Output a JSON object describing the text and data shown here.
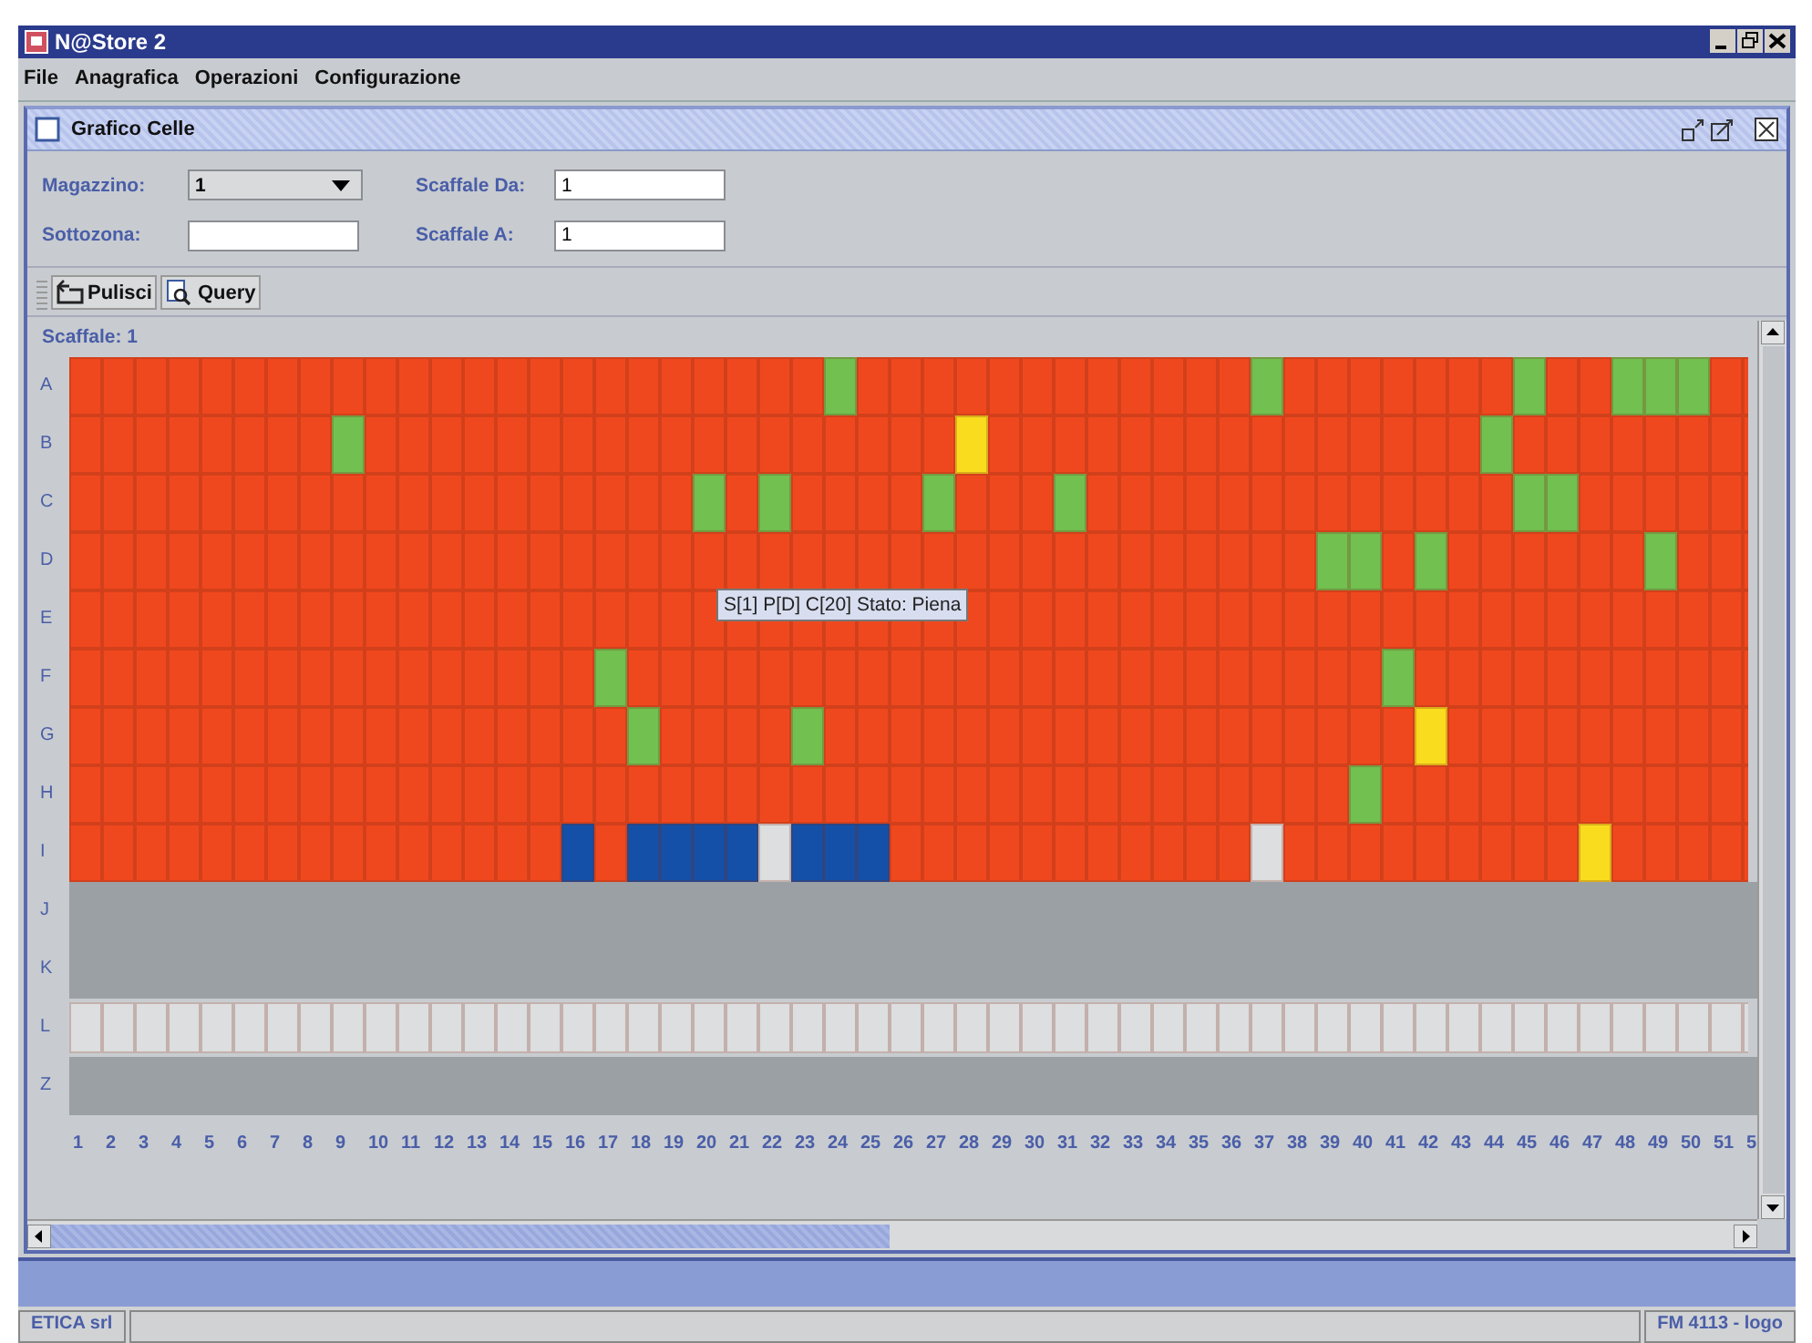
{
  "window": {
    "title": "N@Store 2"
  },
  "menu": [
    "File",
    "Anagrafica",
    "Operazioni",
    "Configurazione"
  ],
  "frame": {
    "title": "Grafico Celle"
  },
  "form": {
    "magazzino_label": "Magazzino:",
    "magazzino_value": "1",
    "sottozona_label": "Sottozona:",
    "scaffale_da_label": "Scaffale Da:",
    "scaffale_da_value": "1",
    "scaffale_a_label": "Scaffale A:",
    "scaffale_a_value": "1"
  },
  "toolbar": [
    "Pulisci",
    "Query"
  ],
  "shelf_label": "Scaffale: 1",
  "rows": [
    {
      "label": "A",
      "kind": "cells",
      "cells": [
        {
          "color": "#f0481e"
        },
        {
          "color": "#f0481e"
        },
        {
          "color": "#f0481e"
        },
        {
          "color": "#f0481e"
        },
        {
          "color": "#f0481e"
        },
        {
          "color": "#f0481e"
        },
        {
          "color": "#f0481e"
        },
        {
          "color": "#f0481e"
        },
        {
          "color": "#f0481e"
        },
        {
          "color": "#f0481e"
        },
        {
          "color": "#f0481e"
        },
        {
          "color": "#f0481e"
        },
        {
          "color": "#f0481e"
        },
        {
          "color": "#f0481e"
        },
        {
          "color": "#f0481e"
        },
        {
          "color": "#f0481e"
        },
        {
          "color": "#f0481e"
        },
        {
          "color": "#f0481e"
        },
        {
          "color": "#f0481e"
        },
        {
          "color": "#f0481e"
        },
        {
          "color": "#f0481e"
        },
        {
          "color": "#f0481e"
        },
        {
          "color": "#f0481e"
        },
        {
          "color": "#72c050"
        },
        {
          "color": "#f0481e"
        },
        {
          "color": "#f0481e"
        },
        {
          "color": "#f0481e"
        },
        {
          "color": "#f0481e"
        },
        {
          "color": "#f0481e"
        },
        {
          "color": "#f0481e"
        },
        {
          "color": "#f0481e"
        },
        {
          "color": "#f0481e"
        },
        {
          "color": "#f0481e"
        },
        {
          "color": "#f0481e"
        },
        {
          "color": "#f0481e"
        },
        {
          "color": "#f0481e"
        },
        {
          "color": "#72c050"
        },
        {
          "color": "#f0481e"
        },
        {
          "color": "#f0481e"
        },
        {
          "color": "#f0481e"
        },
        {
          "color": "#f0481e"
        },
        {
          "color": "#f0481e"
        },
        {
          "color": "#f0481e"
        },
        {
          "color": "#f0481e"
        },
        {
          "color": "#72c050"
        },
        {
          "color": "#f0481e"
        },
        {
          "color": "#f0481e"
        },
        {
          "color": "#72c050"
        },
        {
          "color": "#72c050"
        },
        {
          "color": "#72c050"
        },
        {
          "color": "#f0481e"
        },
        {
          "color": "#f0481e"
        }
      ]
    },
    {
      "label": "B",
      "kind": "cells",
      "cells": [
        {
          "color": "#f0481e"
        },
        {
          "color": "#f0481e"
        },
        {
          "color": "#f0481e"
        },
        {
          "color": "#f0481e"
        },
        {
          "color": "#f0481e"
        },
        {
          "color": "#f0481e"
        },
        {
          "color": "#f0481e"
        },
        {
          "color": "#f0481e"
        },
        {
          "color": "#72c050"
        },
        {
          "color": "#f0481e"
        },
        {
          "color": "#f0481e"
        },
        {
          "color": "#f0481e"
        },
        {
          "color": "#f0481e"
        },
        {
          "color": "#f0481e"
        },
        {
          "color": "#f0481e"
        },
        {
          "color": "#f0481e"
        },
        {
          "color": "#f0481e"
        },
        {
          "color": "#f0481e"
        },
        {
          "color": "#f0481e"
        },
        {
          "color": "#f0481e"
        },
        {
          "color": "#f0481e"
        },
        {
          "color": "#f0481e"
        },
        {
          "color": "#f0481e"
        },
        {
          "color": "#f0481e"
        },
        {
          "color": "#f0481e"
        },
        {
          "color": "#f0481e"
        },
        {
          "color": "#f0481e"
        },
        {
          "color": "#fadc1e"
        },
        {
          "color": "#f0481e"
        },
        {
          "color": "#f0481e"
        },
        {
          "color": "#f0481e"
        },
        {
          "color": "#f0481e"
        },
        {
          "color": "#f0481e"
        },
        {
          "color": "#f0481e"
        },
        {
          "color": "#f0481e"
        },
        {
          "color": "#f0481e"
        },
        {
          "color": "#f0481e"
        },
        {
          "color": "#f0481e"
        },
        {
          "color": "#f0481e"
        },
        {
          "color": "#f0481e"
        },
        {
          "color": "#f0481e"
        },
        {
          "color": "#f0481e"
        },
        {
          "color": "#f0481e"
        },
        {
          "color": "#72c050"
        },
        {
          "color": "#f0481e"
        },
        {
          "color": "#f0481e"
        },
        {
          "color": "#f0481e"
        },
        {
          "color": "#f0481e"
        },
        {
          "color": "#f0481e"
        },
        {
          "color": "#f0481e"
        },
        {
          "color": "#f0481e"
        },
        {
          "color": "#f0481e"
        }
      ]
    },
    {
      "label": "C",
      "kind": "cells",
      "cells": [
        {
          "color": "#f0481e"
        },
        {
          "color": "#f0481e"
        },
        {
          "color": "#f0481e"
        },
        {
          "color": "#f0481e"
        },
        {
          "color": "#f0481e"
        },
        {
          "color": "#f0481e"
        },
        {
          "color": "#f0481e"
        },
        {
          "color": "#f0481e"
        },
        {
          "color": "#f0481e"
        },
        {
          "color": "#f0481e"
        },
        {
          "color": "#f0481e"
        },
        {
          "color": "#f0481e"
        },
        {
          "color": "#f0481e"
        },
        {
          "color": "#f0481e"
        },
        {
          "color": "#f0481e"
        },
        {
          "color": "#f0481e"
        },
        {
          "color": "#f0481e"
        },
        {
          "color": "#f0481e"
        },
        {
          "color": "#f0481e"
        },
        {
          "color": "#72c050"
        },
        {
          "color": "#f0481e"
        },
        {
          "color": "#72c050"
        },
        {
          "color": "#f0481e"
        },
        {
          "color": "#f0481e"
        },
        {
          "color": "#f0481e"
        },
        {
          "color": "#f0481e"
        },
        {
          "color": "#72c050"
        },
        {
          "color": "#f0481e"
        },
        {
          "color": "#f0481e"
        },
        {
          "color": "#f0481e"
        },
        {
          "color": "#72c050"
        },
        {
          "color": "#f0481e"
        },
        {
          "color": "#f0481e"
        },
        {
          "color": "#f0481e"
        },
        {
          "color": "#f0481e"
        },
        {
          "color": "#f0481e"
        },
        {
          "color": "#f0481e"
        },
        {
          "color": "#f0481e"
        },
        {
          "color": "#f0481e"
        },
        {
          "color": "#f0481e"
        },
        {
          "color": "#f0481e"
        },
        {
          "color": "#f0481e"
        },
        {
          "color": "#f0481e"
        },
        {
          "color": "#f0481e"
        },
        {
          "color": "#72c050"
        },
        {
          "color": "#72c050"
        },
        {
          "color": "#f0481e"
        },
        {
          "color": "#f0481e"
        },
        {
          "color": "#f0481e"
        },
        {
          "color": "#f0481e"
        },
        {
          "color": "#f0481e"
        },
        {
          "color": "#f0481e"
        }
      ]
    },
    {
      "label": "D",
      "kind": "cells",
      "cells": [
        {
          "color": "#f0481e"
        },
        {
          "color": "#f0481e"
        },
        {
          "color": "#f0481e"
        },
        {
          "color": "#f0481e"
        },
        {
          "color": "#f0481e"
        },
        {
          "color": "#f0481e"
        },
        {
          "color": "#f0481e"
        },
        {
          "color": "#f0481e"
        },
        {
          "color": "#f0481e"
        },
        {
          "color": "#f0481e"
        },
        {
          "color": "#f0481e"
        },
        {
          "color": "#f0481e"
        },
        {
          "color": "#f0481e"
        },
        {
          "color": "#f0481e"
        },
        {
          "color": "#f0481e"
        },
        {
          "color": "#f0481e"
        },
        {
          "color": "#f0481e"
        },
        {
          "color": "#f0481e"
        },
        {
          "color": "#f0481e"
        },
        {
          "color": "#f0481e"
        },
        {
          "color": "#f0481e"
        },
        {
          "color": "#f0481e"
        },
        {
          "color": "#f0481e"
        },
        {
          "color": "#f0481e"
        },
        {
          "color": "#f0481e"
        },
        {
          "color": "#f0481e"
        },
        {
          "color": "#f0481e"
        },
        {
          "color": "#f0481e"
        },
        {
          "color": "#f0481e"
        },
        {
          "color": "#f0481e"
        },
        {
          "color": "#f0481e"
        },
        {
          "color": "#f0481e"
        },
        {
          "color": "#f0481e"
        },
        {
          "color": "#f0481e"
        },
        {
          "color": "#f0481e"
        },
        {
          "color": "#f0481e"
        },
        {
          "color": "#f0481e"
        },
        {
          "color": "#f0481e"
        },
        {
          "color": "#72c050"
        },
        {
          "color": "#72c050"
        },
        {
          "color": "#f0481e"
        },
        {
          "color": "#72c050"
        },
        {
          "color": "#f0481e"
        },
        {
          "color": "#f0481e"
        },
        {
          "color": "#f0481e"
        },
        {
          "color": "#f0481e"
        },
        {
          "color": "#f0481e"
        },
        {
          "color": "#f0481e"
        },
        {
          "color": "#72c050"
        },
        {
          "color": "#f0481e"
        },
        {
          "color": "#f0481e"
        },
        {
          "color": "#f0481e"
        }
      ]
    },
    {
      "label": "E",
      "kind": "cells",
      "cells": [
        {
          "color": "#f0481e"
        },
        {
          "color": "#f0481e"
        },
        {
          "color": "#f0481e"
        },
        {
          "color": "#f0481e"
        },
        {
          "color": "#f0481e"
        },
        {
          "color": "#f0481e"
        },
        {
          "color": "#f0481e"
        },
        {
          "color": "#f0481e"
        },
        {
          "color": "#f0481e"
        },
        {
          "color": "#f0481e"
        },
        {
          "color": "#f0481e"
        },
        {
          "color": "#f0481e"
        },
        {
          "color": "#f0481e"
        },
        {
          "color": "#f0481e"
        },
        {
          "color": "#f0481e"
        },
        {
          "color": "#f0481e"
        },
        {
          "color": "#f0481e"
        },
        {
          "color": "#f0481e"
        },
        {
          "color": "#f0481e"
        },
        {
          "color": "#f0481e"
        },
        {
          "color": "#f0481e"
        },
        {
          "color": "#f0481e"
        },
        {
          "color": "#f0481e"
        },
        {
          "color": "#f0481e"
        },
        {
          "color": "#f0481e"
        },
        {
          "color": "#f0481e"
        },
        {
          "color": "#f0481e"
        },
        {
          "color": "#f0481e"
        },
        {
          "color": "#f0481e"
        },
        {
          "color": "#f0481e"
        },
        {
          "color": "#f0481e"
        },
        {
          "color": "#f0481e"
        },
        {
          "color": "#f0481e"
        },
        {
          "color": "#f0481e"
        },
        {
          "color": "#f0481e"
        },
        {
          "color": "#f0481e"
        },
        {
          "color": "#f0481e"
        },
        {
          "color": "#f0481e"
        },
        {
          "color": "#f0481e"
        },
        {
          "color": "#f0481e"
        },
        {
          "color": "#f0481e"
        },
        {
          "color": "#f0481e"
        },
        {
          "color": "#f0481e"
        },
        {
          "color": "#f0481e"
        },
        {
          "color": "#f0481e"
        },
        {
          "color": "#f0481e"
        },
        {
          "color": "#f0481e"
        },
        {
          "color": "#f0481e"
        },
        {
          "color": "#f0481e"
        },
        {
          "color": "#f0481e"
        },
        {
          "color": "#f0481e"
        },
        {
          "color": "#f0481e"
        }
      ]
    },
    {
      "label": "F",
      "kind": "cells",
      "cells": [
        {
          "color": "#f0481e"
        },
        {
          "color": "#f0481e"
        },
        {
          "color": "#f0481e"
        },
        {
          "color": "#f0481e"
        },
        {
          "color": "#f0481e"
        },
        {
          "color": "#f0481e"
        },
        {
          "color": "#f0481e"
        },
        {
          "color": "#f0481e"
        },
        {
          "color": "#f0481e"
        },
        {
          "color": "#f0481e"
        },
        {
          "color": "#f0481e"
        },
        {
          "color": "#f0481e"
        },
        {
          "color": "#f0481e"
        },
        {
          "color": "#f0481e"
        },
        {
          "color": "#f0481e"
        },
        {
          "color": "#f0481e"
        },
        {
          "color": "#72c050"
        },
        {
          "color": "#f0481e"
        },
        {
          "color": "#f0481e"
        },
        {
          "color": "#f0481e"
        },
        {
          "color": "#f0481e"
        },
        {
          "color": "#f0481e"
        },
        {
          "color": "#f0481e"
        },
        {
          "color": "#f0481e"
        },
        {
          "color": "#f0481e"
        },
        {
          "color": "#f0481e"
        },
        {
          "color": "#f0481e"
        },
        {
          "color": "#f0481e"
        },
        {
          "color": "#f0481e"
        },
        {
          "color": "#f0481e"
        },
        {
          "color": "#f0481e"
        },
        {
          "color": "#f0481e"
        },
        {
          "color": "#f0481e"
        },
        {
          "color": "#f0481e"
        },
        {
          "color": "#f0481e"
        },
        {
          "color": "#f0481e"
        },
        {
          "color": "#f0481e"
        },
        {
          "color": "#f0481e"
        },
        {
          "color": "#f0481e"
        },
        {
          "color": "#f0481e"
        },
        {
          "color": "#72c050"
        },
        {
          "color": "#f0481e"
        },
        {
          "color": "#f0481e"
        },
        {
          "color": "#f0481e"
        },
        {
          "color": "#f0481e"
        },
        {
          "color": "#f0481e"
        },
        {
          "color": "#f0481e"
        },
        {
          "color": "#f0481e"
        },
        {
          "color": "#f0481e"
        },
        {
          "color": "#f0481e"
        },
        {
          "color": "#f0481e"
        },
        {
          "color": "#f0481e"
        }
      ]
    },
    {
      "label": "G",
      "kind": "cells",
      "cells": [
        {
          "color": "#f0481e"
        },
        {
          "color": "#f0481e"
        },
        {
          "color": "#f0481e"
        },
        {
          "color": "#f0481e"
        },
        {
          "color": "#f0481e"
        },
        {
          "color": "#f0481e"
        },
        {
          "color": "#f0481e"
        },
        {
          "color": "#f0481e"
        },
        {
          "color": "#f0481e"
        },
        {
          "color": "#f0481e"
        },
        {
          "color": "#f0481e"
        },
        {
          "color": "#f0481e"
        },
        {
          "color": "#f0481e"
        },
        {
          "color": "#f0481e"
        },
        {
          "color": "#f0481e"
        },
        {
          "color": "#f0481e"
        },
        {
          "color": "#f0481e"
        },
        {
          "color": "#72c050"
        },
        {
          "color": "#f0481e"
        },
        {
          "color": "#f0481e"
        },
        {
          "color": "#f0481e"
        },
        {
          "color": "#f0481e"
        },
        {
          "color": "#72c050"
        },
        {
          "color": "#f0481e"
        },
        {
          "color": "#f0481e"
        },
        {
          "color": "#f0481e"
        },
        {
          "color": "#f0481e"
        },
        {
          "color": "#f0481e"
        },
        {
          "color": "#f0481e"
        },
        {
          "color": "#f0481e"
        },
        {
          "color": "#f0481e"
        },
        {
          "color": "#f0481e"
        },
        {
          "color": "#f0481e"
        },
        {
          "color": "#f0481e"
        },
        {
          "color": "#f0481e"
        },
        {
          "color": "#f0481e"
        },
        {
          "color": "#f0481e"
        },
        {
          "color": "#f0481e"
        },
        {
          "color": "#f0481e"
        },
        {
          "color": "#f0481e"
        },
        {
          "color": "#f0481e"
        },
        {
          "color": "#fadc1e"
        },
        {
          "color": "#f0481e"
        },
        {
          "color": "#f0481e"
        },
        {
          "color": "#f0481e"
        },
        {
          "color": "#f0481e"
        },
        {
          "color": "#f0481e"
        },
        {
          "color": "#f0481e"
        },
        {
          "color": "#f0481e"
        },
        {
          "color": "#f0481e"
        },
        {
          "color": "#f0481e"
        },
        {
          "color": "#f0481e"
        }
      ]
    },
    {
      "label": "H",
      "kind": "cells",
      "cells": [
        {
          "color": "#f0481e"
        },
        {
          "color": "#f0481e"
        },
        {
          "color": "#f0481e"
        },
        {
          "color": "#f0481e"
        },
        {
          "color": "#f0481e"
        },
        {
          "color": "#f0481e"
        },
        {
          "color": "#f0481e"
        },
        {
          "color": "#f0481e"
        },
        {
          "color": "#f0481e"
        },
        {
          "color": "#f0481e"
        },
        {
          "color": "#f0481e"
        },
        {
          "color": "#f0481e"
        },
        {
          "color": "#f0481e"
        },
        {
          "color": "#f0481e"
        },
        {
          "color": "#f0481e"
        },
        {
          "color": "#f0481e"
        },
        {
          "color": "#f0481e"
        },
        {
          "color": "#f0481e"
        },
        {
          "color": "#f0481e"
        },
        {
          "color": "#f0481e"
        },
        {
          "color": "#f0481e"
        },
        {
          "color": "#f0481e"
        },
        {
          "color": "#f0481e"
        },
        {
          "color": "#f0481e"
        },
        {
          "color": "#f0481e"
        },
        {
          "color": "#f0481e"
        },
        {
          "color": "#f0481e"
        },
        {
          "color": "#f0481e"
        },
        {
          "color": "#f0481e"
        },
        {
          "color": "#f0481e"
        },
        {
          "color": "#f0481e"
        },
        {
          "color": "#f0481e"
        },
        {
          "color": "#f0481e"
        },
        {
          "color": "#f0481e"
        },
        {
          "color": "#f0481e"
        },
        {
          "color": "#f0481e"
        },
        {
          "color": "#f0481e"
        },
        {
          "color": "#f0481e"
        },
        {
          "color": "#f0481e"
        },
        {
          "color": "#72c050"
        },
        {
          "color": "#f0481e"
        },
        {
          "color": "#f0481e"
        },
        {
          "color": "#f0481e"
        },
        {
          "color": "#f0481e"
        },
        {
          "color": "#f0481e"
        },
        {
          "color": "#f0481e"
        },
        {
          "color": "#f0481e"
        },
        {
          "color": "#f0481e"
        },
        {
          "color": "#f0481e"
        },
        {
          "color": "#f0481e"
        },
        {
          "color": "#f0481e"
        },
        {
          "color": "#f0481e"
        }
      ]
    },
    {
      "label": "I",
      "kind": "cells",
      "cells": [
        {
          "color": "#f0481e"
        },
        {
          "color": "#f0481e"
        },
        {
          "color": "#f0481e"
        },
        {
          "color": "#f0481e"
        },
        {
          "color": "#f0481e"
        },
        {
          "color": "#f0481e"
        },
        {
          "color": "#f0481e"
        },
        {
          "color": "#f0481e"
        },
        {
          "color": "#f0481e"
        },
        {
          "color": "#f0481e"
        },
        {
          "color": "#f0481e"
        },
        {
          "color": "#f0481e"
        },
        {
          "color": "#f0481e"
        },
        {
          "color": "#f0481e"
        },
        {
          "color": "#f0481e"
        },
        {
          "color": "#1450a8"
        },
        {
          "color": "#f0481e"
        },
        {
          "color": "#1450a8"
        },
        {
          "color": "#1450a8"
        },
        {
          "color": "#1450a8"
        },
        {
          "color": "#1450a8"
        },
        {
          "color": "#dcdedf"
        },
        {
          "color": "#1450a8"
        },
        {
          "color": "#1450a8"
        },
        {
          "color": "#1450a8"
        },
        {
          "color": "#f0481e"
        },
        {
          "color": "#f0481e"
        },
        {
          "color": "#f0481e"
        },
        {
          "color": "#f0481e"
        },
        {
          "color": "#f0481e"
        },
        {
          "color": "#f0481e"
        },
        {
          "color": "#f0481e"
        },
        {
          "color": "#f0481e"
        },
        {
          "color": "#f0481e"
        },
        {
          "color": "#f0481e"
        },
        {
          "color": "#f0481e"
        },
        {
          "color": "#dcdedf"
        },
        {
          "color": "#f0481e"
        },
        {
          "color": "#f0481e"
        },
        {
          "color": "#f0481e"
        },
        {
          "color": "#f0481e"
        },
        {
          "color": "#f0481e"
        },
        {
          "color": "#f0481e"
        },
        {
          "color": "#f0481e"
        },
        {
          "color": "#f0481e"
        },
        {
          "color": "#f0481e"
        },
        {
          "color": "#fadc1e"
        },
        {
          "color": "#f0481e"
        },
        {
          "color": "#f0481e"
        },
        {
          "color": "#f0481e"
        },
        {
          "color": "#f0481e"
        },
        {
          "color": "#f0481e"
        }
      ]
    },
    {
      "label": "J",
      "kind": "blank"
    },
    {
      "label": "K",
      "kind": "blank"
    },
    {
      "label": "L",
      "kind": "cells",
      "cells": [
        {
          "color": "#dcdedf"
        },
        {
          "color": "#dcdedf"
        },
        {
          "color": "#dcdedf"
        },
        {
          "color": "#dcdedf"
        },
        {
          "color": "#dcdedf"
        },
        {
          "color": "#dcdedf"
        },
        {
          "color": "#dcdedf"
        },
        {
          "color": "#dcdedf"
        },
        {
          "color": "#dcdedf"
        },
        {
          "color": "#dcdedf"
        },
        {
          "color": "#dcdedf"
        },
        {
          "color": "#dcdedf"
        },
        {
          "color": "#dcdedf"
        },
        {
          "color": "#dcdedf"
        },
        {
          "color": "#dcdedf"
        },
        {
          "color": "#dcdedf"
        },
        {
          "color": "#dcdedf"
        },
        {
          "color": "#dcdedf"
        },
        {
          "color": "#dcdedf"
        },
        {
          "color": "#dcdedf"
        },
        {
          "color": "#dcdedf"
        },
        {
          "color": "#dcdedf"
        },
        {
          "color": "#dcdedf"
        },
        {
          "color": "#dcdedf"
        },
        {
          "color": "#dcdedf"
        },
        {
          "color": "#dcdedf"
        },
        {
          "color": "#dcdedf"
        },
        {
          "color": "#dcdedf"
        },
        {
          "color": "#dcdedf"
        },
        {
          "color": "#dcdedf"
        },
        {
          "color": "#dcdedf"
        },
        {
          "color": "#dcdedf"
        },
        {
          "color": "#dcdedf"
        },
        {
          "color": "#dcdedf"
        },
        {
          "color": "#dcdedf"
        },
        {
          "color": "#dcdedf"
        },
        {
          "color": "#dcdedf"
        },
        {
          "color": "#dcdedf"
        },
        {
          "color": "#dcdedf"
        },
        {
          "color": "#dcdedf"
        },
        {
          "color": "#dcdedf"
        },
        {
          "color": "#dcdedf"
        },
        {
          "color": "#dcdedf"
        },
        {
          "color": "#dcdedf"
        },
        {
          "color": "#dcdedf"
        },
        {
          "color": "#dcdedf"
        },
        {
          "color": "#dcdedf"
        },
        {
          "color": "#dcdedf"
        },
        {
          "color": "#dcdedf"
        },
        {
          "color": "#dcdedf"
        },
        {
          "color": "#dcdedf"
        },
        {
          "color": "#dcdedf"
        }
      ]
    },
    {
      "label": "Z",
      "kind": "blank"
    }
  ],
  "columns": [
    "1",
    "2",
    "3",
    "4",
    "5",
    "6",
    "7",
    "8",
    "9",
    "10",
    "11",
    "12",
    "13",
    "14",
    "15",
    "16",
    "17",
    "18",
    "19",
    "20",
    "21",
    "22",
    "23",
    "24",
    "25",
    "26",
    "27",
    "28",
    "29",
    "30",
    "31",
    "32",
    "33",
    "34",
    "35",
    "36",
    "37",
    "38",
    "39",
    "40",
    "41",
    "42",
    "43",
    "44",
    "45",
    "46",
    "47",
    "48",
    "49",
    "50",
    "51",
    "5"
  ],
  "tooltip": "S[1] P[D] C[20] Stato: Piena",
  "status_bar": {
    "left": "ETICA srl",
    "right": "FM 4113 - logo"
  }
}
